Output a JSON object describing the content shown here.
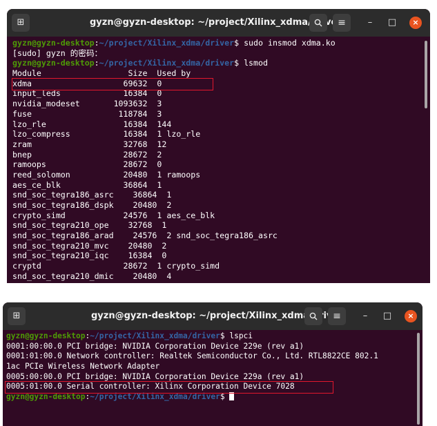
{
  "terminal1": {
    "title": "gyzn@gyzn-desktop: ~/project/Xilinx_xdma/driver",
    "newtab_icon": "⊞",
    "search_icon": "🔍",
    "menu_icon": "≡",
    "minimize_icon": "–",
    "maximize_icon": "□",
    "close_icon": "×",
    "prompt_user": "gyzn@gyzn-desktop",
    "prompt_path": "~/project/Xilinx_xdma/driver",
    "lines": [
      {
        "type": "prompt",
        "cmd": " sudo insmod xdma.ko"
      },
      {
        "type": "text",
        "text": "[sudo] gyzn 的密码："
      },
      {
        "type": "prompt",
        "cmd": " lsmod"
      },
      {
        "type": "text",
        "text": "Module                  Size  Used by"
      },
      {
        "type": "text",
        "text": "xdma                   69632  0"
      },
      {
        "type": "text",
        "text": "input_leds             16384  0"
      },
      {
        "type": "text",
        "text": "nvidia_modeset       1093632  3"
      },
      {
        "type": "text",
        "text": "fuse                  118784  3"
      },
      {
        "type": "text",
        "text": "lzo_rle                16384  144"
      },
      {
        "type": "text",
        "text": "lzo_compress           16384  1 lzo_rle"
      },
      {
        "type": "text",
        "text": "zram                   32768  12"
      },
      {
        "type": "text",
        "text": "bnep                   28672  2"
      },
      {
        "type": "text",
        "text": "ramoops                28672  0"
      },
      {
        "type": "text",
        "text": "reed_solomon           20480  1 ramoops"
      },
      {
        "type": "text",
        "text": "aes_ce_blk             36864  1"
      },
      {
        "type": "text",
        "text": "snd_soc_tegra186_asrc    36864  1"
      },
      {
        "type": "text",
        "text": "snd_soc_tegra186_dspk    20480  2"
      },
      {
        "type": "text",
        "text": "crypto_simd            24576  1 aes_ce_blk"
      },
      {
        "type": "text",
        "text": "snd_soc_tegra210_ope    32768  1"
      },
      {
        "type": "text",
        "text": "snd_soc_tegra186_arad    24576  2 snd_soc_tegra186_asrc"
      },
      {
        "type": "text",
        "text": "snd_soc_tegra210_mvc    20480  2"
      },
      {
        "type": "text",
        "text": "snd_soc_tegra210_iqc    16384  0"
      },
      {
        "type": "text",
        "text": "cryptd                 28672  1 crypto_simd"
      },
      {
        "type": "text",
        "text": "snd_soc_tegra210_dmic    20480  4"
      }
    ]
  },
  "terminal2": {
    "title": "gyzn@gyzn-desktop: ~/project/Xilinx_xdma/driver",
    "newtab_icon": "⊞",
    "search_icon": "🔍",
    "menu_icon": "≡",
    "minimize_icon": "–",
    "maximize_icon": "□",
    "close_icon": "×",
    "prompt_user": "gyzn@gyzn-desktop",
    "prompt_path": "~/project/Xilinx_xdma/driver",
    "lines": [
      {
        "type": "prompt",
        "cmd": " lspci"
      },
      {
        "type": "text",
        "text": "0001:00:00.0 PCI bridge: NVIDIA Corporation Device 229e (rev a1)"
      },
      {
        "type": "text",
        "text": "0001:01:00.0 Network controller: Realtek Semiconductor Co., Ltd. RTL8822CE 802.1"
      },
      {
        "type": "text",
        "text": "1ac PCIe Wireless Network Adapter"
      },
      {
        "type": "text",
        "text": "0005:00:00.0 PCI bridge: NVIDIA Corporation Device 229a (rev a1)"
      },
      {
        "type": "text",
        "text": "0005:01:00.0 Serial controller: Xilinx Corporation Device 7028"
      },
      {
        "type": "prompt",
        "cmd": " ",
        "cursor": true
      }
    ]
  },
  "colors": {
    "terminal_bg": "#300a24",
    "titlebar_bg": "#2c2c2c",
    "prompt_user": "#4e9a06",
    "prompt_path": "#3465a4",
    "highlight_box": "#e3172d",
    "close_button": "#e95420"
  }
}
